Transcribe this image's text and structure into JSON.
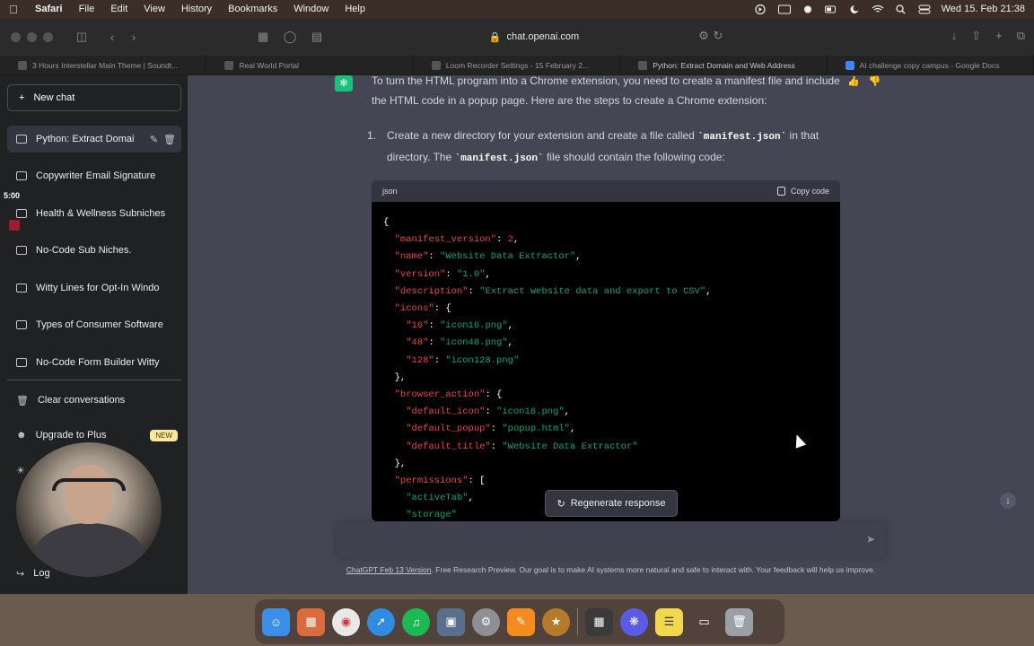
{
  "menubar": {
    "app": "Safari",
    "items": [
      "File",
      "Edit",
      "View",
      "History",
      "Bookmarks",
      "Window",
      "Help"
    ],
    "clock": "Wed 15. Feb 21:38"
  },
  "browser": {
    "url": "chat.openai.com",
    "tabs": [
      "3 Hours Interstellar Main Theme | Soundt...",
      "Real World Portal",
      "Loom Recorder Settings - 15 February 2...",
      "Python: Extract Domain and Web Address",
      "AI challenge copy campus - Google Docs"
    ]
  },
  "sidebar": {
    "new_chat": "New chat",
    "conversations": [
      "Python: Extract Domai",
      "Copywriter Email Signature",
      "Health & Wellness Subniches",
      "No-Code Sub Niches.",
      "Witty Lines for Opt-In Windo",
      "Types of Consumer Software",
      "No-Code Form Builder Witty"
    ],
    "clear": "Clear conversations",
    "upgrade": "Upgrade to Plus",
    "upgrade_badge": "NEW",
    "logout": "Log"
  },
  "recording": {
    "timer": "5:00"
  },
  "message": {
    "intro": "To turn the HTML program into a Chrome extension, you need to create a manifest file and include the HTML code in a popup page. Here are the steps to create a Chrome extension:",
    "step_number": "1.",
    "step_text_a": "Create a new directory for your extension and create a file called ",
    "step_code_a": "`manifest.json`",
    "step_text_b": " in that directory. The ",
    "step_code_b": "`manifest.json`",
    "step_text_c": " file should contain the following code:"
  },
  "codeblock": {
    "language": "json",
    "copy_label": "Copy code",
    "lines": [
      "{",
      "  \"manifest_version\": 2,",
      "  \"name\": \"Website Data Extractor\",",
      "  \"version\": \"1.0\",",
      "  \"description\": \"Extract website data and export to CSV\",",
      "  \"icons\": {",
      "    \"16\": \"icon16.png\",",
      "    \"48\": \"icon48.png\",",
      "    \"128\": \"icon128.png\"",
      "  },",
      "  \"browser_action\": {",
      "    \"default_icon\": \"icon16.png\",",
      "    \"default_popup\": \"popup.html\",",
      "    \"default_title\": \"Website Data Extractor\"",
      "  },",
      "  \"permissions\": [",
      "    \"activeTab\",",
      "    \"storage\""
    ]
  },
  "regenerate": "Regenerate response",
  "input": {
    "placeholder": ""
  },
  "footer": {
    "version_link": "ChatGPT Feb 13 Version",
    "text": ". Free Research Preview. Our goal is to make AI systems more natural and safe to interact with. Your feedback will help us improve."
  },
  "colors": {
    "sidebar": "#202123",
    "main": "#444654",
    "code_bg": "#000000",
    "key": "#ef4146",
    "string": "#00a67d",
    "number": "#df3079"
  }
}
